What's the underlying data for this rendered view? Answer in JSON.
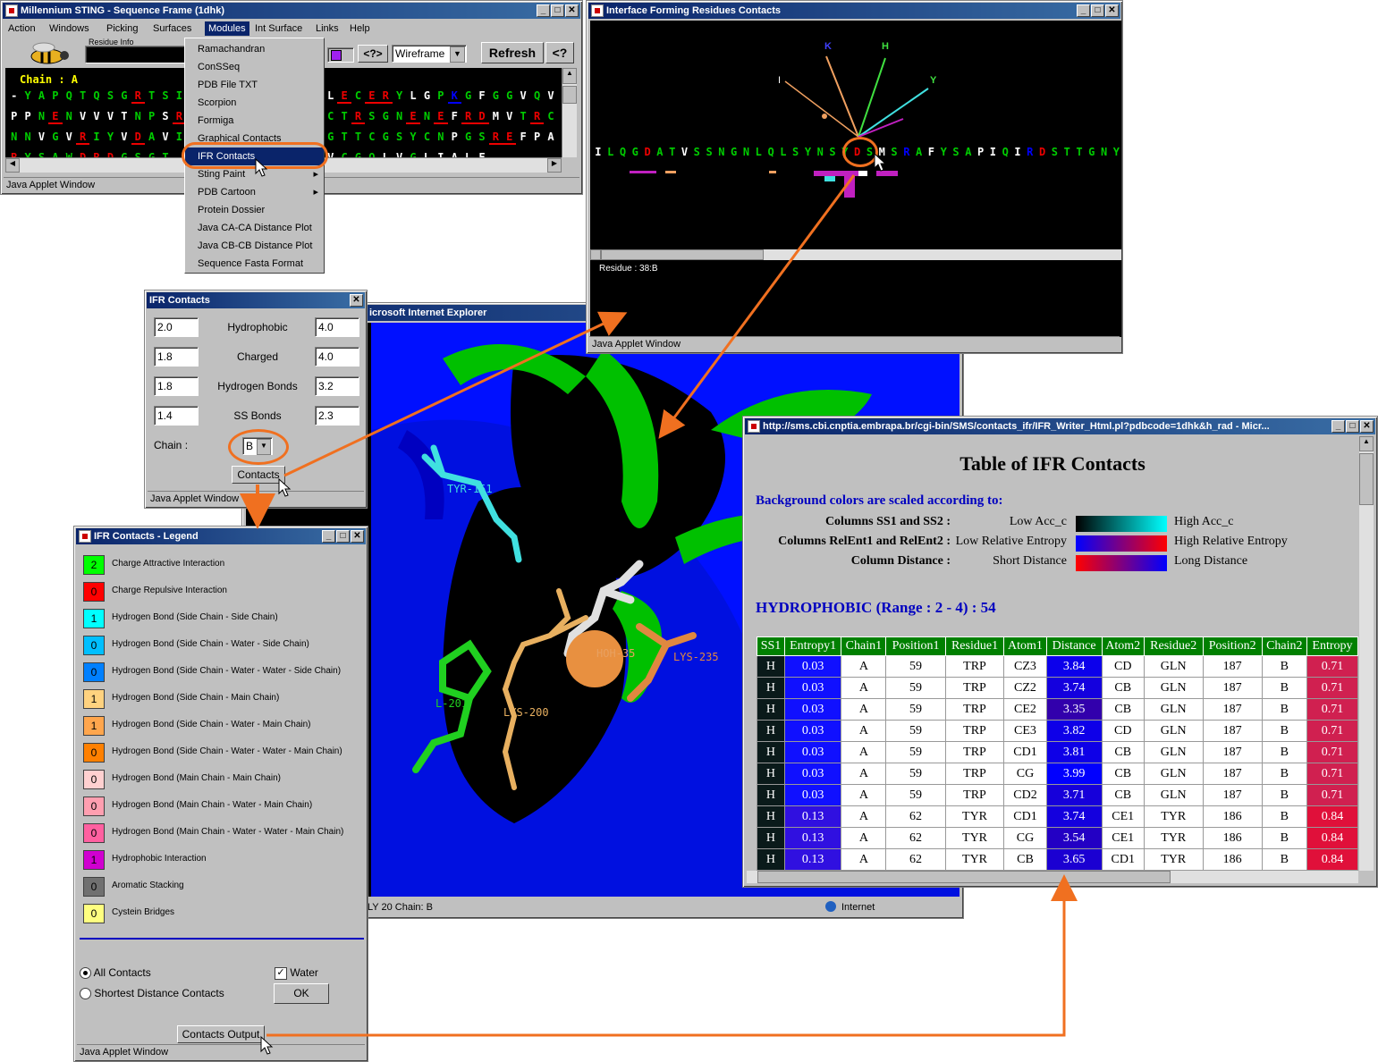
{
  "seq_window": {
    "title": "Millennium STING - Sequence Frame (1dhk)",
    "menus": [
      "Action",
      "Windows",
      "Picking",
      "Surfaces",
      "Modules",
      "Int Surface",
      "Links",
      "Help"
    ],
    "residue_info_label": "Residue Info",
    "help_btn": "<?>",
    "render_mode": "Wireframe",
    "refresh": "Refresh",
    "help2": "<?",
    "chain_label": "Chain : A",
    "status": "Java Applet Window",
    "rows": [
      {
        "text": "-YAPQTQSGRTSIV",
        "colors": [
          "#fff",
          "#0c0",
          "#0c0",
          "#0c0",
          "#0c0",
          "#0c0",
          "#0c0",
          "#0c0",
          "#0c0",
          "#e00",
          "#0c0",
          "#0c0",
          "#0c0",
          "#0c0"
        ]
      },
      {
        "text": "PPNENVVVTNPSRP",
        "colors": [
          "#fff",
          "#fff",
          "#0c0",
          "#e00",
          "#0c0",
          "#fff",
          "#fff",
          "#fff",
          "#fff",
          "#0c0",
          "#0c0",
          "#fff",
          "#e00",
          "#00f"
        ]
      },
      {
        "text": "NNVGVRIYVDAVIN",
        "colors": [
          "#0c0",
          "#0c0",
          "#fff",
          "#0c0",
          "#fff",
          "#e00",
          "#0c0",
          "#0c0",
          "#fff",
          "#e00",
          "#0c0",
          "#fff",
          "#0c0",
          "#0c0"
        ]
      },
      {
        "text": "RYSAWDRDGSGT",
        "colors": [
          "#e00",
          "#0c0",
          "#0c0",
          "#0c0",
          "#0c0",
          "#e00",
          "#e00",
          "#e00",
          "#0c0",
          "#0c0",
          "#0c0",
          "#0c0"
        ]
      }
    ],
    "rows_right": [
      {
        "text": "LECERYLGPKGFGGVQVS",
        "colors": [
          "#fff",
          "#e00",
          "#0c0",
          "#e00",
          "#e00",
          "#0c0",
          "#fff",
          "#fff",
          "#0c0",
          "#00f",
          "#0c0",
          "#fff",
          "#0c0",
          "#0c0",
          "#fff",
          "#0c0",
          "#fff",
          "#0c0"
        ]
      },
      {
        "text": "CTRSGNENEFRDMVTRC",
        "colors": [
          "#0c0",
          "#0c0",
          "#e00",
          "#0c0",
          "#0c0",
          "#0c0",
          "#e00",
          "#0c0",
          "#e00",
          "#fff",
          "#e00",
          "#e00",
          "#fff",
          "#fff",
          "#0c0",
          "#e00",
          "#0c0"
        ]
      },
      {
        "text": "GTTCGSYCNPGSREFPAV",
        "colors": [
          "#0c0",
          "#0c0",
          "#0c0",
          "#0c0",
          "#0c0",
          "#0c0",
          "#0c0",
          "#0c0",
          "#0c0",
          "#fff",
          "#0c0",
          "#0c0",
          "#e00",
          "#e00",
          "#fff",
          "#fff",
          "#fff",
          "#fff"
        ]
      },
      {
        "text": "VCGQLVGLIALF",
        "colors": [
          "#fff",
          "#0c0",
          "#0c0",
          "#0c0",
          "#fff",
          "#fff",
          "#0c0",
          "#fff",
          "#fff",
          "#fff",
          "#fff",
          "#fff"
        ]
      }
    ]
  },
  "modules_menu": {
    "items": [
      "Ramachandran",
      "ConSSeq",
      "PDB File TXT",
      "Scorpion",
      "Formiga",
      "Graphical Contacts",
      "IFR Contacts",
      "Sting Paint",
      "PDB Cartoon",
      "Protein Dossier",
      "Java CA-CA Distance Plot",
      "Java CB-CB Distance Plot",
      "Sequence Fasta Format"
    ],
    "selected_index": 6
  },
  "ifr_window": {
    "title": "Interface Forming Residues Contacts",
    "labels": [
      "K",
      "H",
      "I",
      "Y"
    ],
    "sequence": "ILQGDATVSSNGNLQLSYNSYDSMSRAFYSAPIQIRDSTTGNY",
    "residue_text": "Residue : 38:B",
    "status": "Java Applet Window"
  },
  "ie_window": {
    "title": "Microsoft Internet Explorer",
    "title_visible": "icrosoft Internet Explorer",
    "mol_labels": [
      "TYR-151",
      "HOH-35",
      "LYS-235",
      "LYS-200",
      "L-201"
    ],
    "status_text": "LY 20  Chain: B",
    "status_zone": "Internet"
  },
  "contacts_dialog": {
    "title": "IFR Contacts",
    "rows": [
      {
        "left": "2.0",
        "label": "Hydrophobic",
        "right": "4.0"
      },
      {
        "left": "1.8",
        "label": "Charged",
        "right": "4.0"
      },
      {
        "left": "1.8",
        "label": "Hydrogen Bonds",
        "right": "3.2"
      },
      {
        "left": "1.4",
        "label": "SS Bonds",
        "right": "2.3"
      }
    ],
    "chain_label": "Chain :",
    "chain_value": "B",
    "contacts_btn": "Contacts",
    "status": "Java Applet Window"
  },
  "legend_window": {
    "title": "IFR Contacts - Legend",
    "items": [
      {
        "count": "2",
        "color": "#00ff00",
        "label": "Charge Attractive Interaction"
      },
      {
        "count": "0",
        "color": "#ff0000",
        "label": "Charge Repulsive Interaction"
      },
      {
        "count": "1",
        "color": "#00ffff",
        "label": "Hydrogen Bond (Side Chain - Side Chain)"
      },
      {
        "count": "0",
        "color": "#00bfff",
        "label": "Hydrogen Bond (Side Chain - Water - Side Chain)"
      },
      {
        "count": "0",
        "color": "#0080ff",
        "label": "Hydrogen Bond (Side Chain - Water - Water - Side Chain)"
      },
      {
        "count": "1",
        "color": "#ffd27f",
        "label": "Hydrogen Bond (Side Chain - Main Chain)"
      },
      {
        "count": "1",
        "color": "#ffa64d",
        "label": "Hydrogen Bond (Side Chain - Water - Main Chain)"
      },
      {
        "count": "0",
        "color": "#ff8000",
        "label": "Hydrogen Bond (Side Chain - Water - Water - Main Chain)"
      },
      {
        "count": "0",
        "color": "#ffd0d0",
        "label": "Hydrogen Bond (Main Chain - Main Chain)"
      },
      {
        "count": "0",
        "color": "#ff9fb0",
        "label": "Hydrogen Bond (Main Chain - Water - Main Chain)"
      },
      {
        "count": "0",
        "color": "#ff60a0",
        "label": "Hydrogen Bond (Main Chain - Water - Water - Main Chain)"
      },
      {
        "count": "1",
        "color": "#d000d0",
        "label": "Hydrophobic Interaction"
      },
      {
        "count": "0",
        "color": "#707070",
        "label": "Aromatic Stacking"
      },
      {
        "count": "0",
        "color": "#ffff80",
        "label": "Cystein Bridges"
      }
    ],
    "all_contacts": "All Contacts",
    "shortest": "Shortest Distance Contacts",
    "water": "Water",
    "ok": "OK",
    "output_btn": "Contacts Output",
    "status": "Java Applet Window"
  },
  "html_window": {
    "title": "http://sms.cbi.cnptia.embrapa.br/cgi-bin/SMS/contacts_ifr/IFR_Writer_Html.pl?pdbcode=1dhk&h_rad - Micr...",
    "heading": "Table of IFR Contacts",
    "bg_note": "Background colors are scaled according to:",
    "scales": [
      {
        "label": "Columns SS1 and SS2 :",
        "low": "Low Acc_c",
        "high": "High Acc_c",
        "grad": "linear-gradient(90deg,#000,#00ffff)"
      },
      {
        "label": "Columns RelEnt1 and RelEnt2 :",
        "low": "Low Relative Entropy",
        "high": "High Relative Entropy",
        "grad": "linear-gradient(90deg,#0000ff,#ff0000)"
      },
      {
        "label": "Column Distance :",
        "low": "Short Distance",
        "high": "Long Distance",
        "grad": "linear-gradient(90deg,#ff0000,#0000ff)"
      }
    ],
    "section": "HYDROPHOBIC (Range : 2 - 4) : 54",
    "headers": [
      "SS1",
      "Entropy1",
      "Chain1",
      "Position1",
      "Residue1",
      "Atom1",
      "Distance",
      "Atom2",
      "Residue2",
      "Position2",
      "Chain2",
      "Entropy"
    ],
    "rows": [
      [
        "H",
        "0.03",
        "A",
        "59",
        "TRP",
        "CZ3",
        "3.84",
        "CD",
        "GLN",
        "187",
        "B",
        "0.71"
      ],
      [
        "H",
        "0.03",
        "A",
        "59",
        "TRP",
        "CZ2",
        "3.74",
        "CB",
        "GLN",
        "187",
        "B",
        "0.71"
      ],
      [
        "H",
        "0.03",
        "A",
        "59",
        "TRP",
        "CE2",
        "3.35",
        "CB",
        "GLN",
        "187",
        "B",
        "0.71"
      ],
      [
        "H",
        "0.03",
        "A",
        "59",
        "TRP",
        "CE3",
        "3.82",
        "CD",
        "GLN",
        "187",
        "B",
        "0.71"
      ],
      [
        "H",
        "0.03",
        "A",
        "59",
        "TRP",
        "CD1",
        "3.81",
        "CB",
        "GLN",
        "187",
        "B",
        "0.71"
      ],
      [
        "H",
        "0.03",
        "A",
        "59",
        "TRP",
        "CG",
        "3.99",
        "CB",
        "GLN",
        "187",
        "B",
        "0.71"
      ],
      [
        "H",
        "0.03",
        "A",
        "59",
        "TRP",
        "CD2",
        "3.71",
        "CB",
        "GLN",
        "187",
        "B",
        "0.71"
      ],
      [
        "H",
        "0.13",
        "A",
        "62",
        "TYR",
        "CD1",
        "3.74",
        "CE1",
        "TYR",
        "186",
        "B",
        "0.84"
      ],
      [
        "H",
        "0.13",
        "A",
        "62",
        "TYR",
        "CG",
        "3.54",
        "CE1",
        "TYR",
        "186",
        "B",
        "0.84"
      ],
      [
        "H",
        "0.13",
        "A",
        "62",
        "TYR",
        "CB",
        "3.65",
        "CD1",
        "TYR",
        "186",
        "B",
        "0.84"
      ]
    ]
  }
}
